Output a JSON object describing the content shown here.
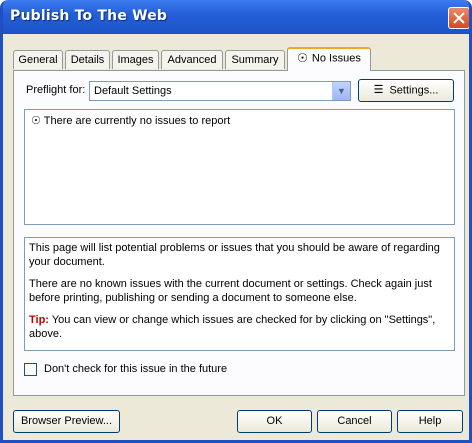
{
  "window": {
    "title": "Publish To The Web"
  },
  "tabs": [
    {
      "label": "General"
    },
    {
      "label": "Details"
    },
    {
      "label": "Images"
    },
    {
      "label": "Advanced"
    },
    {
      "label": "Summary"
    },
    {
      "label": "No Issues",
      "icon": "issue-icon",
      "active": true
    }
  ],
  "preflight": {
    "label": "Preflight for:",
    "value": "Default Settings"
  },
  "settings_button": {
    "label": "Settings..."
  },
  "issues": {
    "message": "There are currently no issues to report"
  },
  "description": {
    "para1": "This page will list potential problems or issues that you should be aware of regarding your document.",
    "para2": "There are no known issues with the current document or settings. Check again just before printing, publishing or sending a document to someone else.",
    "tip_label": "Tip:",
    "tip_text": "You can view or change which issues are checked for by clicking on \"Settings\", above."
  },
  "checkbox": {
    "label": "Don't check for this issue in the future",
    "checked": false
  },
  "buttons": {
    "preview": "Browser Preview...",
    "ok": "OK",
    "cancel": "Cancel",
    "help": "Help"
  },
  "colors": {
    "titlebar": "#2560d8",
    "close": "#d24a1f",
    "tip": "#c00000",
    "tab_highlight": "#f5a623"
  }
}
